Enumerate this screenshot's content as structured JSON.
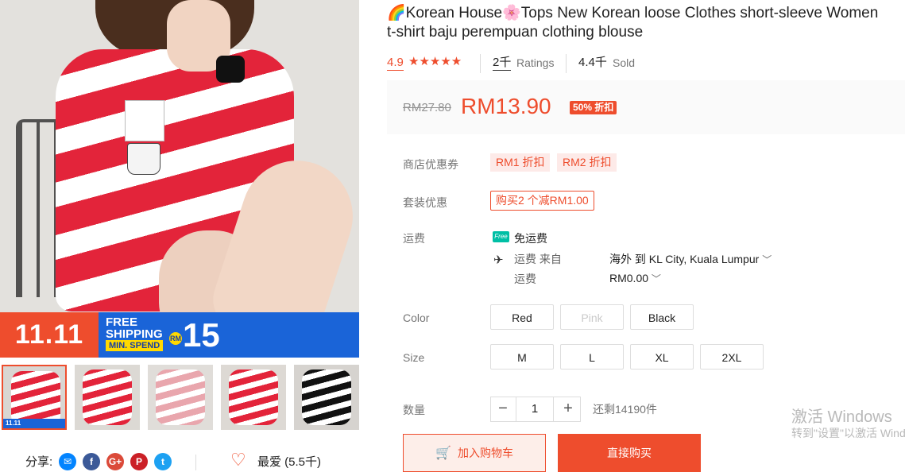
{
  "product": {
    "title_line1": "🌈Korean House🌸Tops New Korean loose Clothes short-sleeve Women",
    "title_line2": "t-shirt baju perempuan clothing blouse",
    "rating": "4.9",
    "stars": "★★★★★",
    "ratings_count": "2千",
    "ratings_label": "Ratings",
    "sold_count": "4.4千",
    "sold_label": "Sold"
  },
  "price": {
    "original": "RM27.80",
    "current": "RM13.90",
    "discount": "50% 折扣"
  },
  "vouchers": {
    "label": "商店优惠券",
    "items": [
      "RM1 折扣",
      "RM2 折扣"
    ]
  },
  "bundle": {
    "label": "套装优惠",
    "deal": "购买2 个减RM1.00"
  },
  "shipping": {
    "label": "运费",
    "free_badge": "Free",
    "free_text": "免运费",
    "from_label": "运费 来自",
    "from_prefix": "海外",
    "to_word": "到",
    "destination": "KL City, Kuala Lumpur",
    "fee_label": "运费",
    "fee_value": "RM0.00"
  },
  "color": {
    "label": "Color",
    "options": [
      "Red",
      "Pink",
      "Black"
    ]
  },
  "size": {
    "label": "Size",
    "options": [
      "M",
      "L",
      "XL",
      "2XL"
    ]
  },
  "quantity": {
    "label": "数量",
    "minus": "−",
    "value": "1",
    "plus": "+",
    "stock": "还剩14190件"
  },
  "actions": {
    "add_to_cart": "加入购物车",
    "buy_now": "直接购买"
  },
  "gallery": {
    "banner_left": "11.11",
    "banner_free": "FREE",
    "banner_shipping": "SHIPPING",
    "banner_min": "MIN. SPEND",
    "banner_rm": "RM",
    "banner_amount": "15",
    "thumb_tag": "11.11"
  },
  "share": {
    "label": "分享:",
    "favorite": "最爱 (5.5千)"
  },
  "watermark": {
    "line1": "激活 Windows",
    "line2": "转到\"设置\"以激活 Windows。"
  },
  "colors": {
    "accent": "#ee4d2d",
    "shirt_red": "#e3243a",
    "banner_blue": "#1a64d8",
    "free_green": "#00bfa5"
  }
}
